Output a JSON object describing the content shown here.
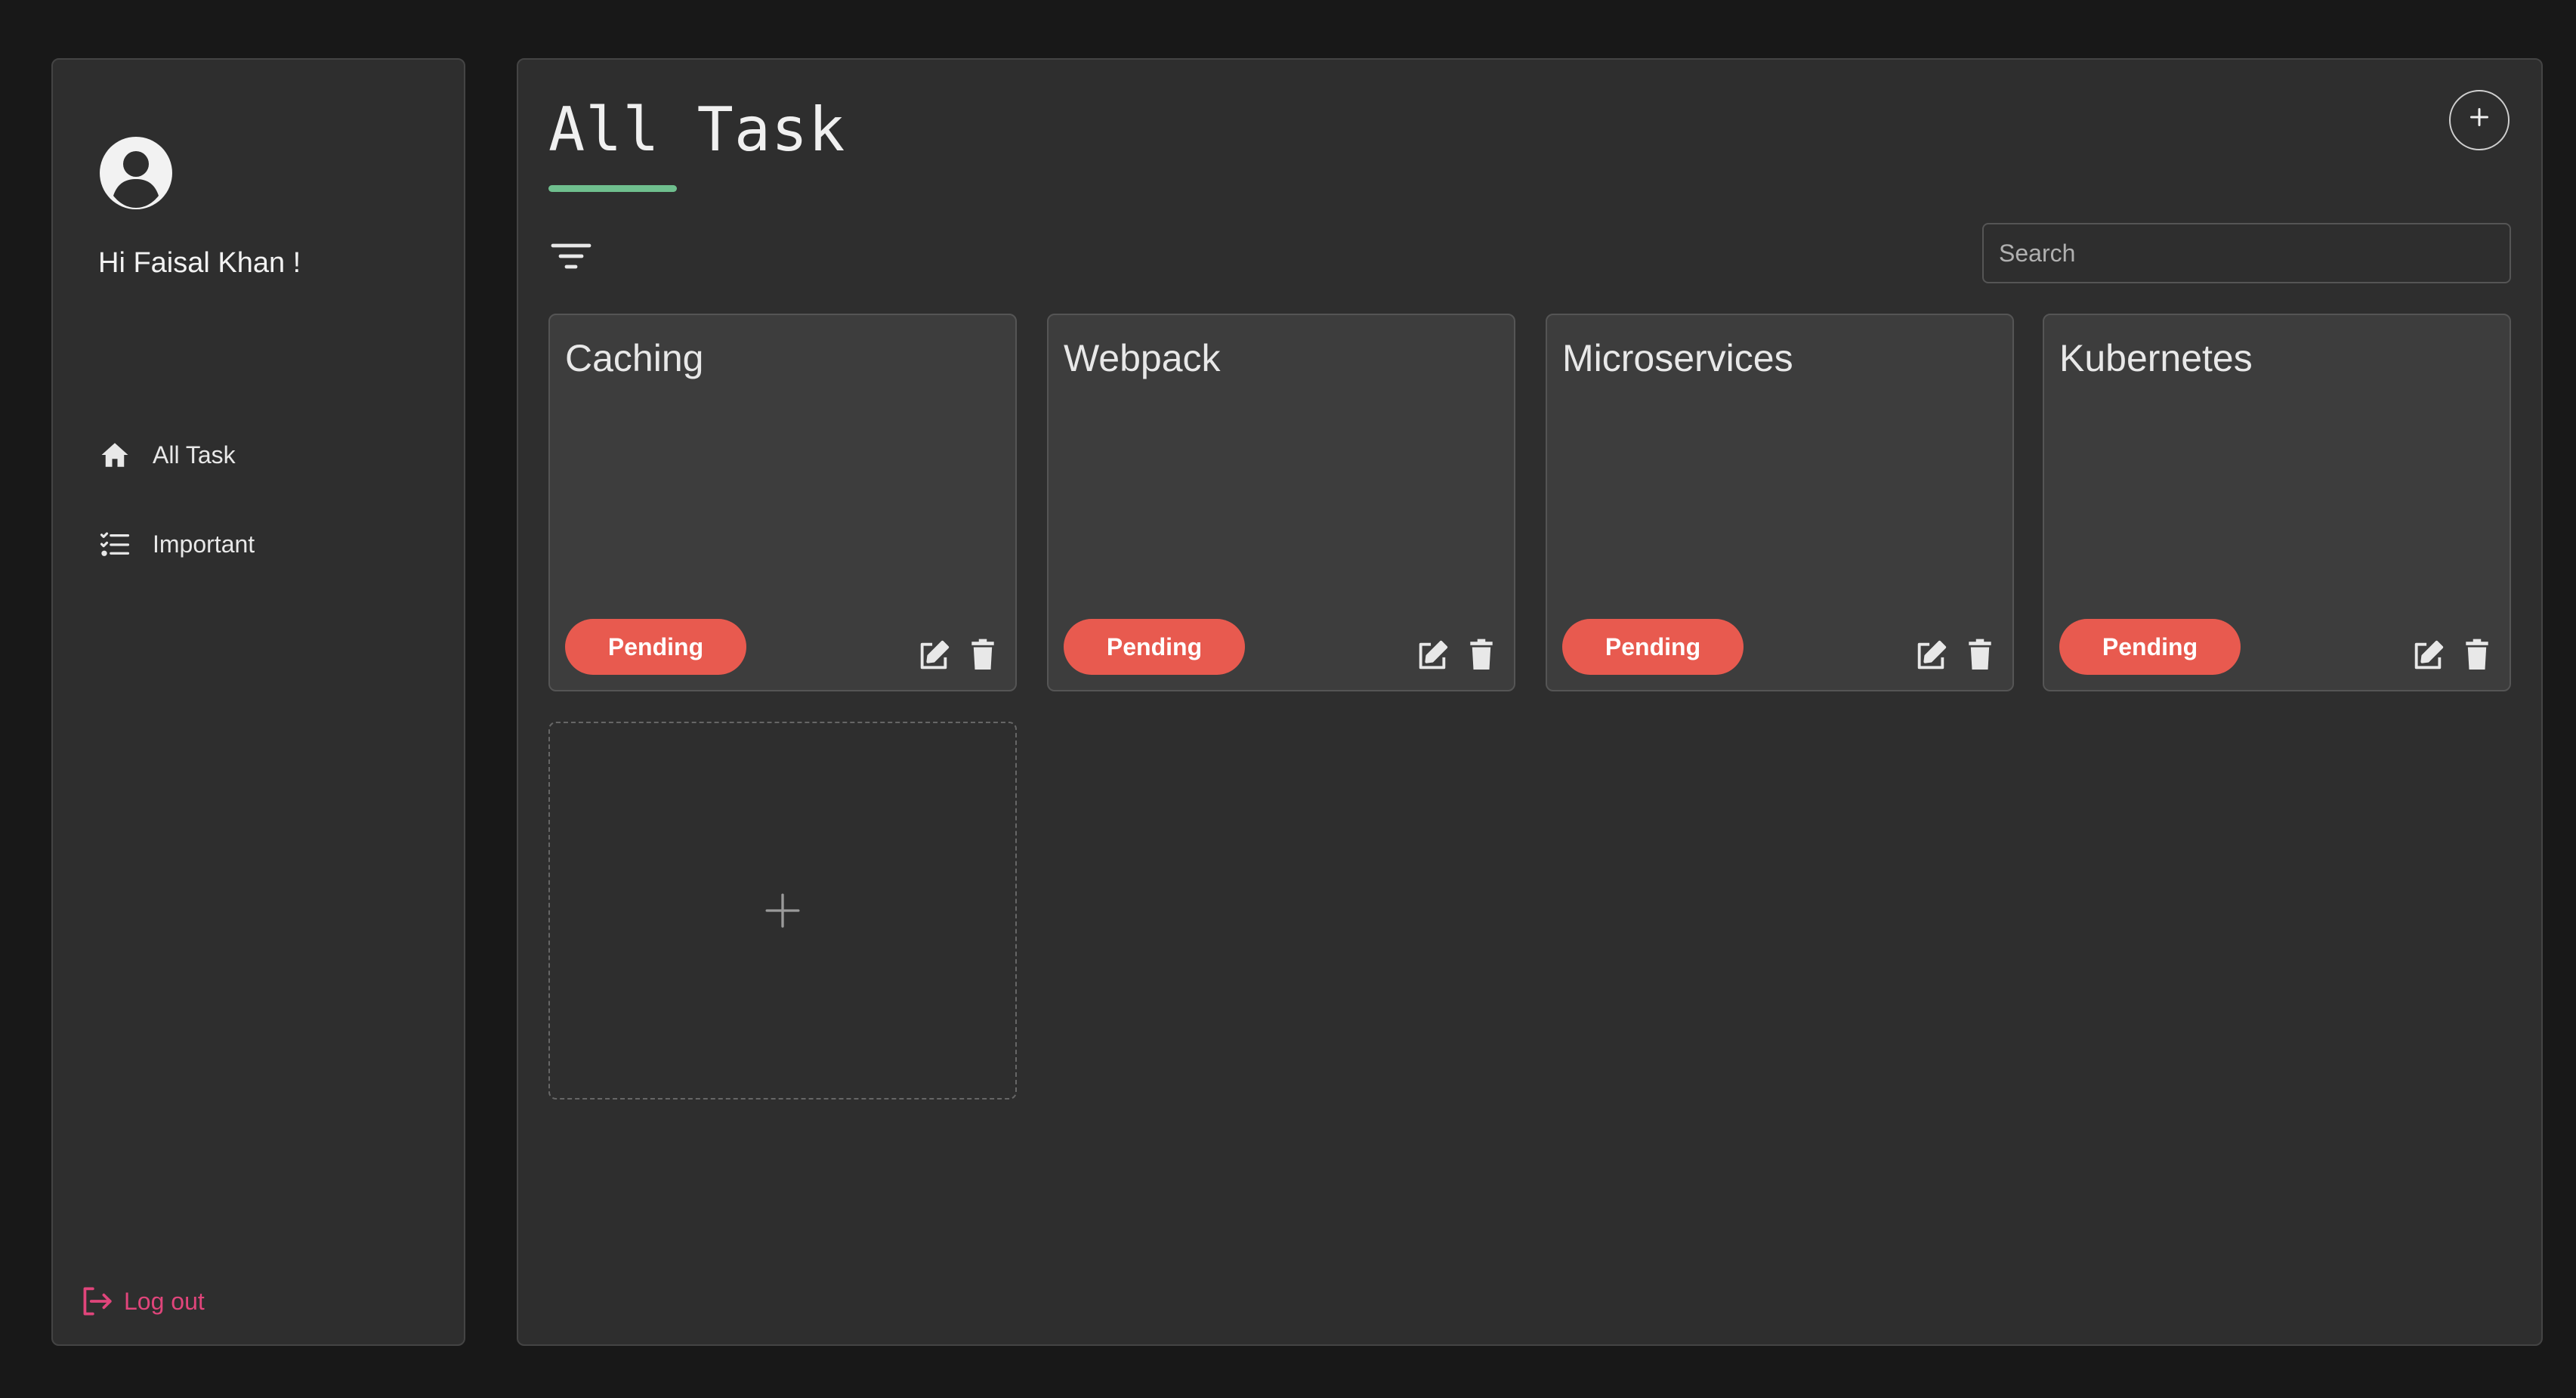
{
  "sidebar": {
    "greeting": "Hi Faisal Khan !",
    "nav": [
      {
        "label": "All Task",
        "icon": "home-icon"
      },
      {
        "label": "Important",
        "icon": "checklist-icon"
      }
    ],
    "logout_label": "Log out"
  },
  "main": {
    "title": "All Task",
    "search_placeholder": "Search",
    "add_icon": "plus-circle-icon",
    "filter_icon": "filter-icon",
    "tasks": [
      {
        "title": "Caching",
        "status": "Pending"
      },
      {
        "title": "Webpack",
        "status": "Pending"
      },
      {
        "title": "Microservices",
        "status": "Pending"
      },
      {
        "title": "Kubernetes",
        "status": "Pending"
      }
    ]
  },
  "colors": {
    "accent_underline": "#6fbf8e",
    "status_pending": "#e85a4f",
    "logout": "#e0457b",
    "background": "#181818",
    "panel": "#2e2e2e",
    "card": "#3d3d3d"
  }
}
